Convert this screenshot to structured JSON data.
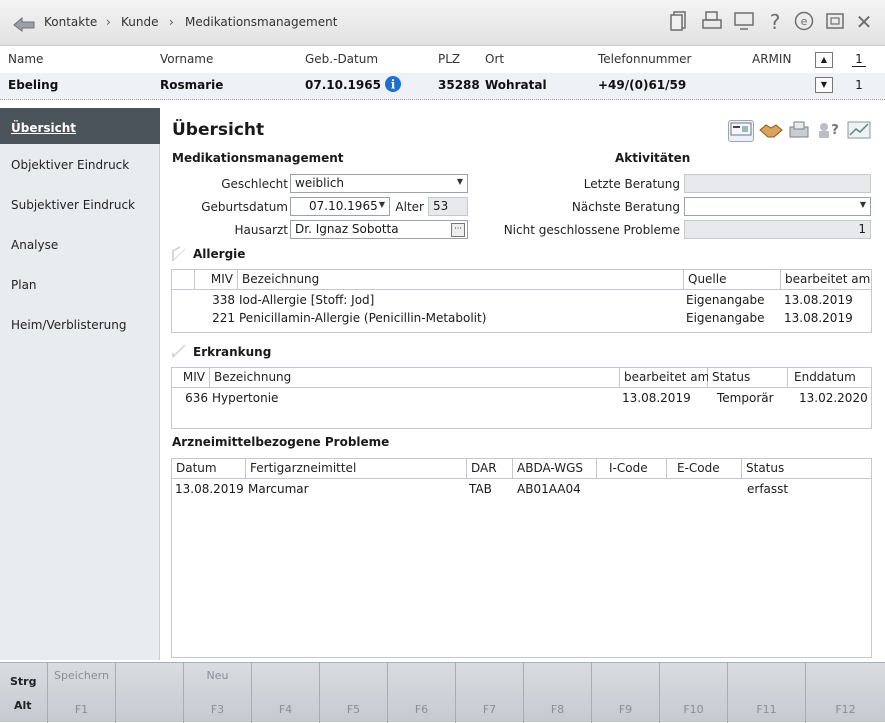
{
  "breadcrumb": [
    "Kontakte",
    "Kunde",
    "Medikationsmanagement"
  ],
  "toolbar_icons": [
    "document-icon",
    "print-icon",
    "monitor-icon",
    "help-icon",
    "e-icon",
    "window-icon",
    "close-icon"
  ],
  "patient": {
    "labels": {
      "name": "Name",
      "vorname": "Vorname",
      "geb": "Geb.-Datum",
      "plz": "PLZ",
      "ort": "Ort",
      "telefon": "Telefonnummer",
      "user": "ARMIN"
    },
    "name": "Ebeling",
    "vorname": "Rosmarie",
    "geb": "07.10.1965",
    "plz": "35288",
    "ort": "Wohratal",
    "telefon": "+49/(0)61/59",
    "counter_top": "1",
    "counter_bottom": "1"
  },
  "sidebar": {
    "items": [
      {
        "label": "Übersicht"
      },
      {
        "label": "Objektiver Eindruck"
      },
      {
        "label": "Subjektiver Eindruck"
      },
      {
        "label": "Analyse"
      },
      {
        "label": "Plan"
      },
      {
        "label": "Heim/Verblisterung"
      }
    ]
  },
  "main": {
    "title": "Übersicht",
    "section_med": "Medikationsmanagement",
    "section_akt": "Aktivitäten",
    "form": {
      "geschlecht_label": "Geschlecht",
      "geschlecht_value": "weiblich",
      "geburtsdatum_label": "Geburtsdatum",
      "geburtsdatum_value": "07.10.1965",
      "alter_label": "Alter",
      "alter_value": "53",
      "hausarzt_label": "Hausarzt",
      "hausarzt_value": "Dr. Ignaz Sobotta",
      "letzte_label": "Letzte Beratung",
      "letzte_value": "",
      "naechste_label": "Nächste Beratung",
      "naechste_value": "",
      "probleme_label": "Nicht geschlossene Probleme",
      "probleme_value": "1"
    },
    "allergie": {
      "title": "Allergie",
      "columns": [
        "MIV",
        "Bezeichnung",
        "Quelle",
        "bearbeitet am"
      ],
      "rows": [
        [
          "338",
          "Iod-Allergie [Stoff: Jod]",
          "Eigenangabe",
          "13.08.2019"
        ],
        [
          "221",
          "Penicillamin-Allergie (Penicillin-Metabolit)",
          "Eigenangabe",
          "13.08.2019"
        ]
      ]
    },
    "erkrankung": {
      "title": "Erkrankung",
      "columns": [
        "MIV",
        "Bezeichnung",
        "bearbeitet am",
        "Status",
        "Enddatum"
      ],
      "rows": [
        [
          "636",
          "Hypertonie",
          "13.08.2019",
          "Temporär",
          "13.02.2020"
        ]
      ]
    },
    "probleme": {
      "title": "Arzneimittelbezogene Probleme",
      "columns": [
        "Datum",
        "Fertigarzneimittel",
        "DAR",
        "ABDA-WGS",
        "I-Code",
        "E-Code",
        "Status"
      ],
      "rows": [
        [
          "13.08.2019",
          "Marcumar",
          "TAB",
          "AB01AA04",
          "",
          "",
          "erfasst"
        ]
      ]
    }
  },
  "fkeys": {
    "strg": "Strg",
    "alt": "Alt",
    "keys": [
      {
        "top": "Speichern",
        "bottom": "F1"
      },
      {
        "top": "",
        "bottom": ""
      },
      {
        "top": "Neu",
        "bottom": "F3"
      },
      {
        "top": "",
        "bottom": "F4"
      },
      {
        "top": "",
        "bottom": "F5"
      },
      {
        "top": "",
        "bottom": "F6"
      },
      {
        "top": "",
        "bottom": "F7"
      },
      {
        "top": "",
        "bottom": "F8"
      },
      {
        "top": "",
        "bottom": "F9"
      },
      {
        "top": "",
        "bottom": "F10"
      },
      {
        "top": "",
        "bottom": "F11"
      },
      {
        "top": "",
        "bottom": "F12"
      }
    ]
  }
}
